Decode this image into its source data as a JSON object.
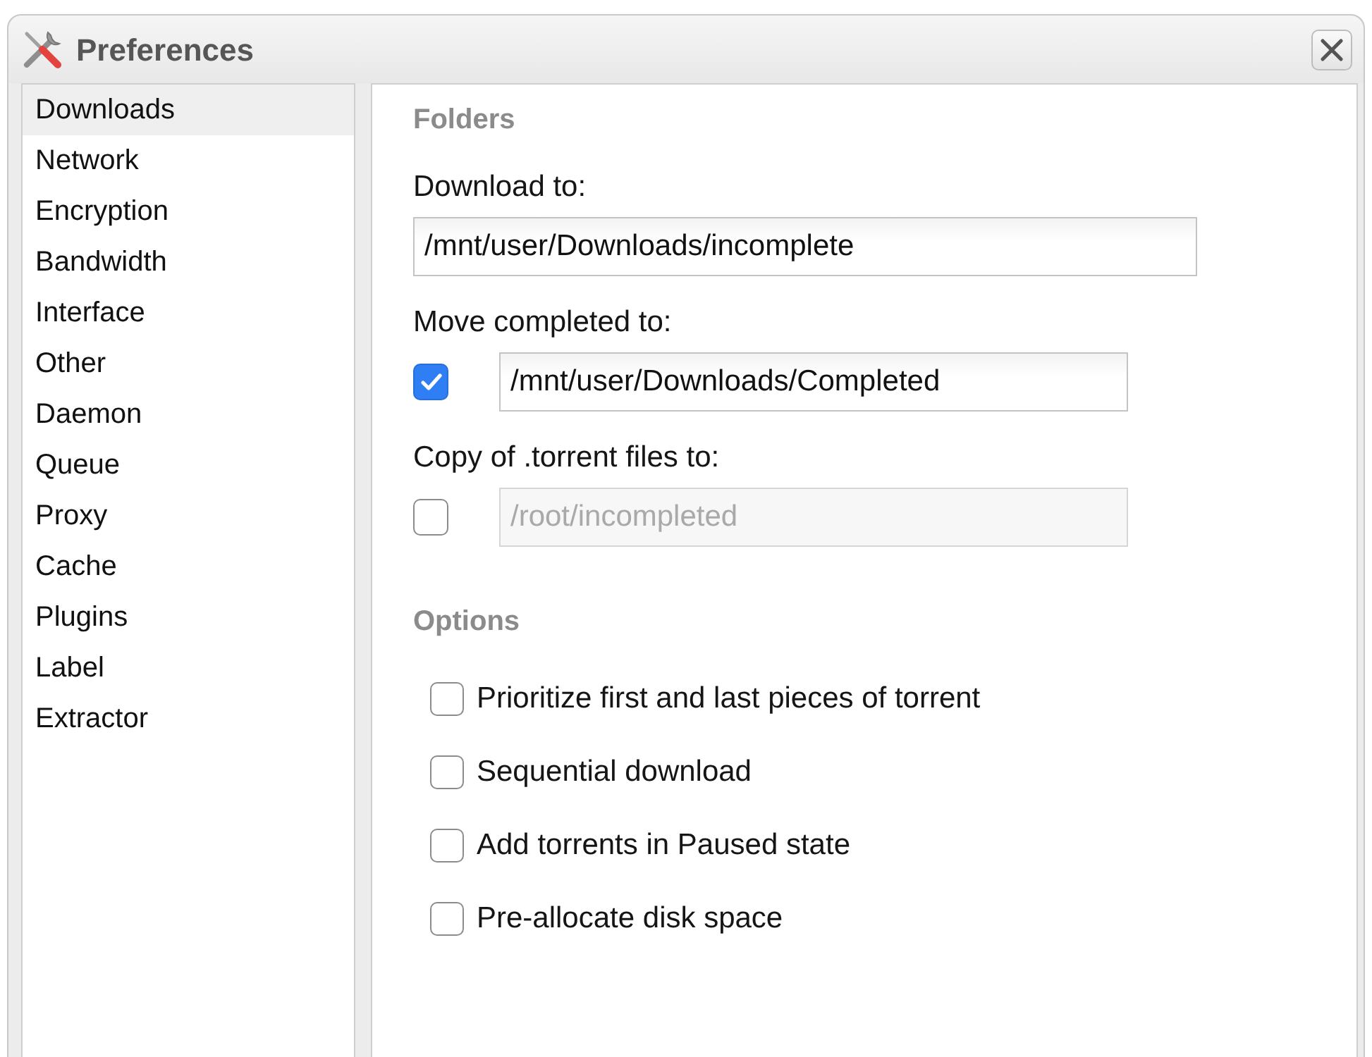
{
  "window": {
    "title": "Preferences"
  },
  "sidebar": {
    "items": [
      {
        "label": "Downloads",
        "selected": true
      },
      {
        "label": "Network",
        "selected": false
      },
      {
        "label": "Encryption",
        "selected": false
      },
      {
        "label": "Bandwidth",
        "selected": false
      },
      {
        "label": "Interface",
        "selected": false
      },
      {
        "label": "Other",
        "selected": false
      },
      {
        "label": "Daemon",
        "selected": false
      },
      {
        "label": "Queue",
        "selected": false
      },
      {
        "label": "Proxy",
        "selected": false
      },
      {
        "label": "Cache",
        "selected": false
      },
      {
        "label": "Plugins",
        "selected": false
      },
      {
        "label": "Label",
        "selected": false
      },
      {
        "label": "Extractor",
        "selected": false
      }
    ]
  },
  "folders": {
    "heading": "Folders",
    "fields": [
      {
        "kind": "path",
        "label": "Download to:",
        "value": "/mnt/user/Downloads/incomplete",
        "disabled": false
      },
      {
        "kind": "checked_path",
        "label": "Move completed to:",
        "checked": true,
        "value": "/mnt/user/Downloads/Completed",
        "disabled": false
      },
      {
        "kind": "checked_path",
        "label": "Copy of .torrent files to:",
        "checked": false,
        "value": "/root/incompleted",
        "disabled": true
      }
    ]
  },
  "options": {
    "heading": "Options",
    "items": [
      {
        "label": "Prioritize first and last pieces of torrent",
        "checked": false
      },
      {
        "label": "Sequential download",
        "checked": false
      },
      {
        "label": "Add torrents in Paused state",
        "checked": false
      },
      {
        "label": "Pre-allocate disk space",
        "checked": false
      }
    ]
  }
}
